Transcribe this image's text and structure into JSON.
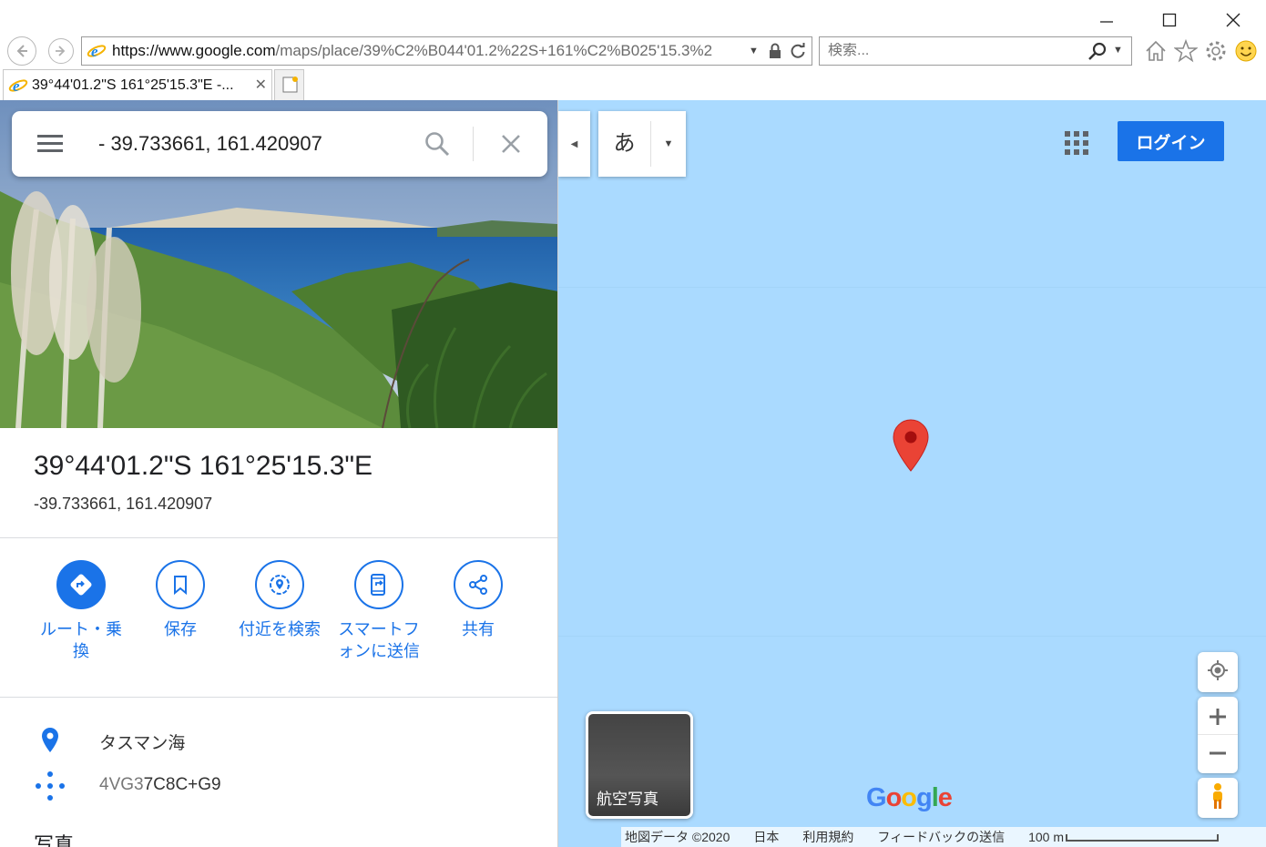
{
  "browser": {
    "url_host": "https://www.google.com",
    "url_path": "/maps/place/39%C2%B044'01.2%22S+161%C2%B025'15.3%2",
    "search_placeholder": "検索...",
    "tab_title": "39°44'01.2\"S 161°25'15.3\"E -..."
  },
  "search": {
    "query": "- 39.733661, 161.420907"
  },
  "place": {
    "title": "39°44'01.2\"S 161°25'15.3\"E",
    "coords": "-39.733661, 161.420907"
  },
  "actions": [
    {
      "label": "ルート・乗換",
      "icon": "directions-icon"
    },
    {
      "label": "保存",
      "icon": "bookmark-icon"
    },
    {
      "label": "付近を検索",
      "icon": "nearby-icon"
    },
    {
      "label": "スマートフォンに送信",
      "icon": "send-to-phone-icon"
    },
    {
      "label": "共有",
      "icon": "share-icon"
    }
  ],
  "info": {
    "location": "タスマン海",
    "pluscode_prefix": "4VG3",
    "pluscode_rest": "7C8C+G9"
  },
  "photos_heading": "写真",
  "map": {
    "ime_key": "あ",
    "login_label": "ログイン",
    "satellite_label": "航空写真",
    "google_logo": "Google",
    "footer": {
      "map_data": "地図データ ©2020",
      "country": "日本",
      "terms": "利用規約",
      "feedback": "フィードバックの送信",
      "scale": "100 m"
    }
  },
  "colors": {
    "accent": "#1a73e8",
    "water": "#aadaff",
    "pin": "#ea4335"
  }
}
